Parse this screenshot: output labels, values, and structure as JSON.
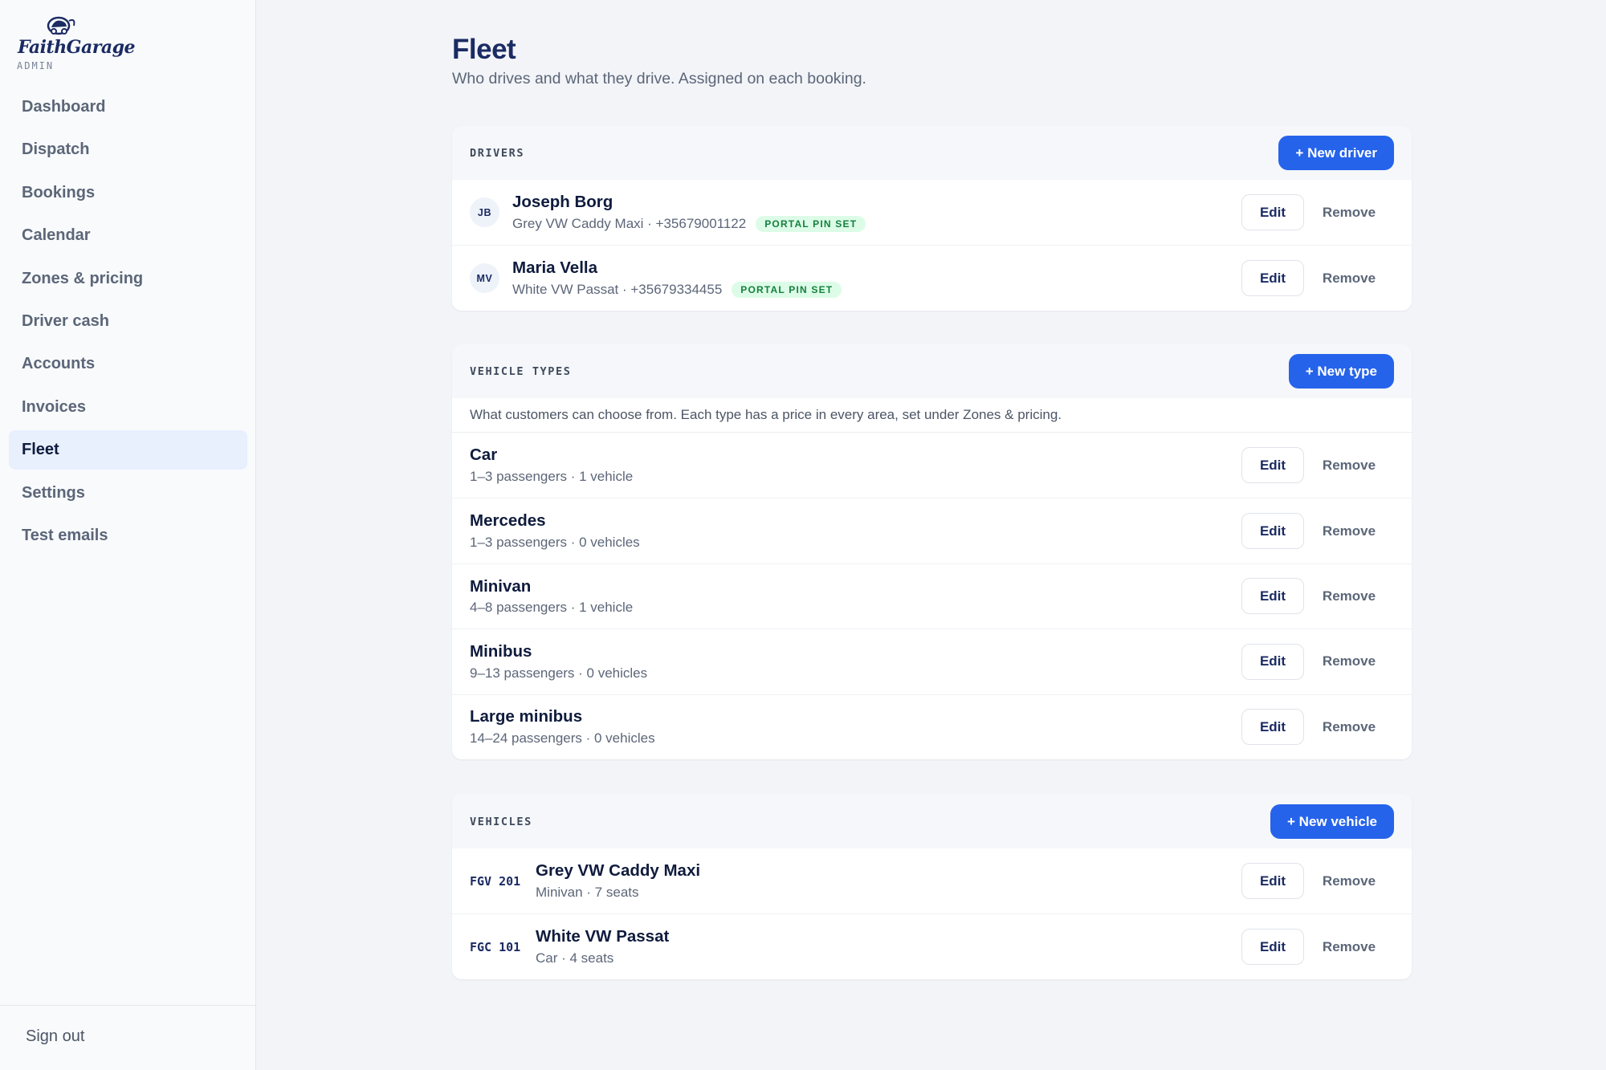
{
  "brand": {
    "name": "FaithGarage",
    "sub": "ADMIN"
  },
  "sidebar": {
    "items": [
      {
        "label": "Dashboard"
      },
      {
        "label": "Dispatch"
      },
      {
        "label": "Bookings"
      },
      {
        "label": "Calendar"
      },
      {
        "label": "Zones & pricing"
      },
      {
        "label": "Driver cash"
      },
      {
        "label": "Accounts"
      },
      {
        "label": "Invoices"
      },
      {
        "label": "Fleet",
        "active": true
      },
      {
        "label": "Settings"
      },
      {
        "label": "Test emails"
      }
    ],
    "sign_out": "Sign out"
  },
  "page": {
    "title": "Fleet",
    "subtitle": "Who drives and what they drive. Assigned on each booking."
  },
  "common": {
    "edit": "Edit",
    "remove": "Remove"
  },
  "drivers": {
    "heading": "DRIVERS",
    "add_label": "+ New driver",
    "rows": [
      {
        "initials": "JB",
        "name": "Joseph Borg",
        "meta": "Grey VW Caddy Maxi · +35679001122",
        "badge": "PORTAL PIN SET"
      },
      {
        "initials": "MV",
        "name": "Maria Vella",
        "meta": "White VW Passat · +35679334455",
        "badge": "PORTAL PIN SET"
      }
    ]
  },
  "vehicle_types": {
    "heading": "VEHICLE TYPES",
    "add_label": "+ New type",
    "note": "What customers can choose from. Each type has a price in every area, set under Zones & pricing.",
    "rows": [
      {
        "name": "Car",
        "meta": "1–3 passengers · 1 vehicle"
      },
      {
        "name": "Mercedes",
        "meta": "1–3 passengers · 0 vehicles"
      },
      {
        "name": "Minivan",
        "meta": "4–8 passengers · 1 vehicle"
      },
      {
        "name": "Minibus",
        "meta": "9–13 passengers · 0 vehicles"
      },
      {
        "name": "Large minibus",
        "meta": "14–24 passengers · 0 vehicles"
      }
    ]
  },
  "vehicles": {
    "heading": "VEHICLES",
    "add_label": "+ New vehicle",
    "rows": [
      {
        "plate": "FGV 201",
        "name": "Grey VW Caddy Maxi",
        "meta": "Minivan · 7 seats"
      },
      {
        "plate": "FGC 101",
        "name": "White VW Passat",
        "meta": "Car · 4 seats"
      }
    ]
  },
  "colors": {
    "accent": "#2563eb",
    "brand_navy": "#1b2b63",
    "badge_bg": "#dcfce7",
    "badge_text": "#15803d",
    "active_nav_bg": "#e8f0fe"
  },
  "icons": {
    "logo": "car-logo-icon"
  }
}
